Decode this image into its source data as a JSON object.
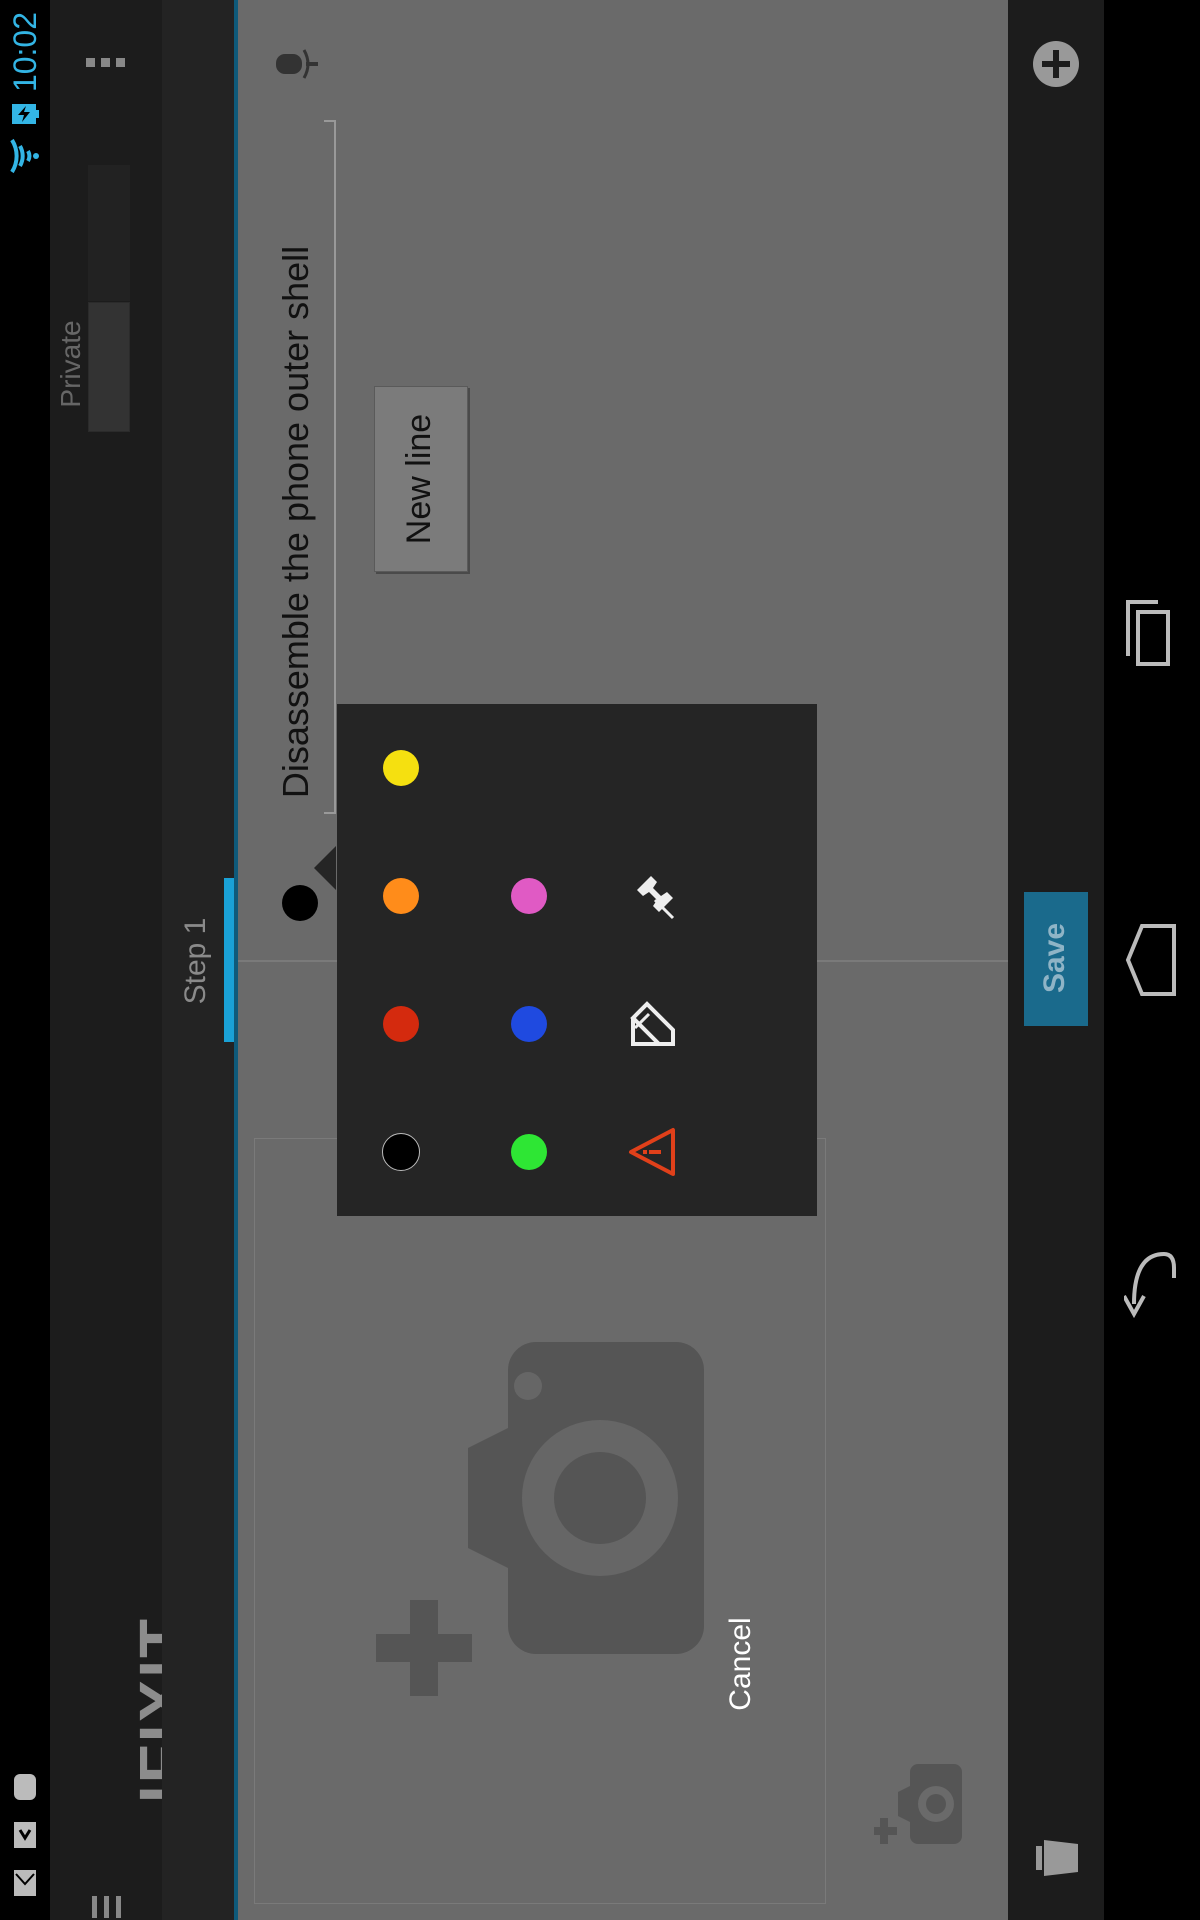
{
  "status_bar": {
    "time": "10:02"
  },
  "action_bar": {
    "logo": "IFIXIT",
    "private_label": "Private"
  },
  "tabs": [
    {
      "label": "Step 1"
    }
  ],
  "editor": {
    "step_title": "Disassemble the phone outer shell",
    "new_line_button": "New line"
  },
  "color_picker": {
    "swatches": [
      {
        "name": "yellow",
        "color": "#f5e010"
      },
      {
        "name": "orange",
        "color": "#ff8c1a"
      },
      {
        "name": "red",
        "color": "#d42a0e"
      },
      {
        "name": "black",
        "color": "#000000"
      },
      {
        "name": "pink",
        "color": "#e05ac4"
      },
      {
        "name": "blue",
        "color": "#1f4ae0"
      },
      {
        "name": "green",
        "color": "#2ee634"
      }
    ],
    "tools": [
      "pin-icon",
      "resize-icon",
      "warning-icon"
    ],
    "cancel_label": "Cancel"
  },
  "right_bar": {
    "save_label": "Save"
  },
  "colors": {
    "accent": "#33b5e5",
    "save": "#1a6a8c",
    "warning": "#e0401a"
  }
}
